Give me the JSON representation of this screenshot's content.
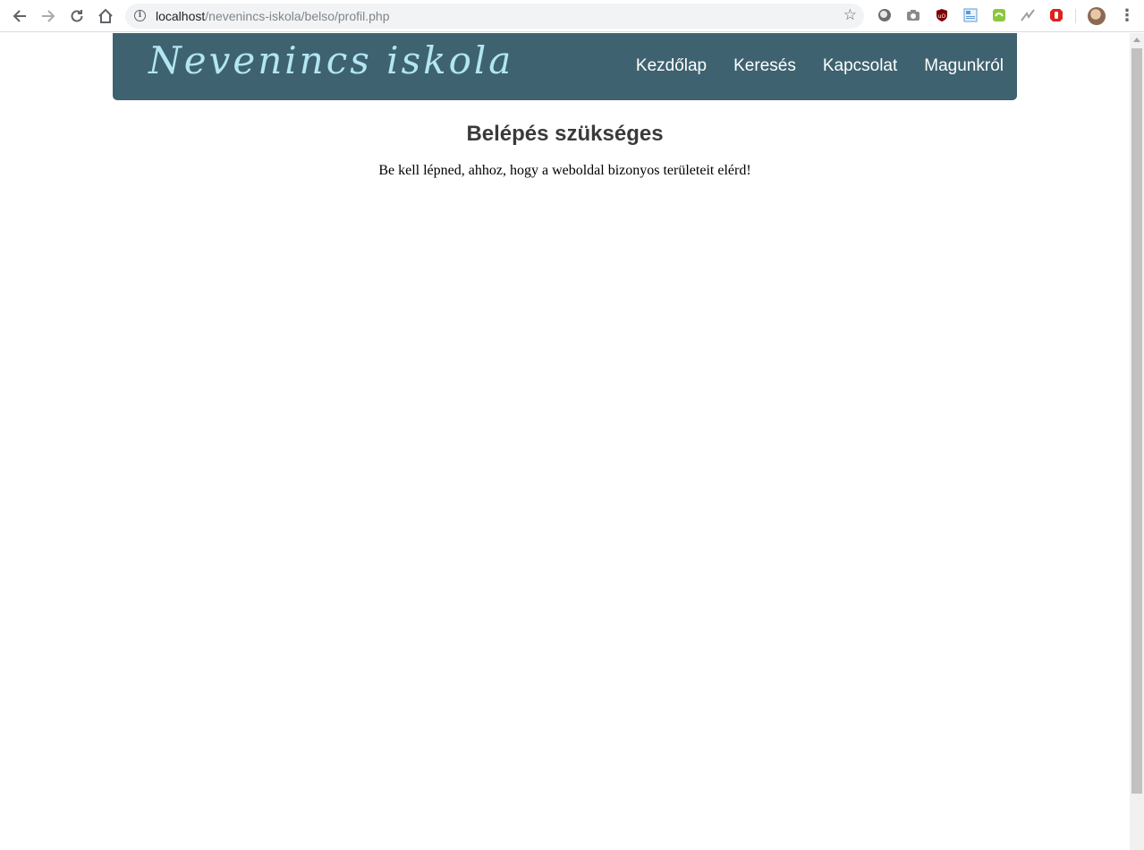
{
  "browser": {
    "url_host": "localhost",
    "url_path": "/nevenincs-iskola/belso/profil.php",
    "extensions": [
      {
        "name": "circle-extension-icon",
        "color": "#6e6e6e"
      },
      {
        "name": "camera-extension-icon",
        "color": "#8a8a8a"
      },
      {
        "name": "ublock-extension-icon",
        "color": "#800000"
      },
      {
        "name": "document-extension-icon",
        "color": "#5b9bd5"
      },
      {
        "name": "green-extension-icon",
        "color": "#8cc63f"
      },
      {
        "name": "wave-extension-icon",
        "color": "#9aa0a6"
      },
      {
        "name": "stop-hand-extension-icon",
        "color": "#e0201b"
      }
    ]
  },
  "header": {
    "logo": "Nevenincs iskola",
    "nav": [
      "Kezdőlap",
      "Keresés",
      "Kapcsolat",
      "Magunkról"
    ],
    "bg_color": "#3e6270",
    "logo_color": "#b2e6f2"
  },
  "main": {
    "title": "Belépés szükséges",
    "message": "Be kell lépned, ahhoz, hogy a weboldal bizonyos területeit elérd!"
  }
}
